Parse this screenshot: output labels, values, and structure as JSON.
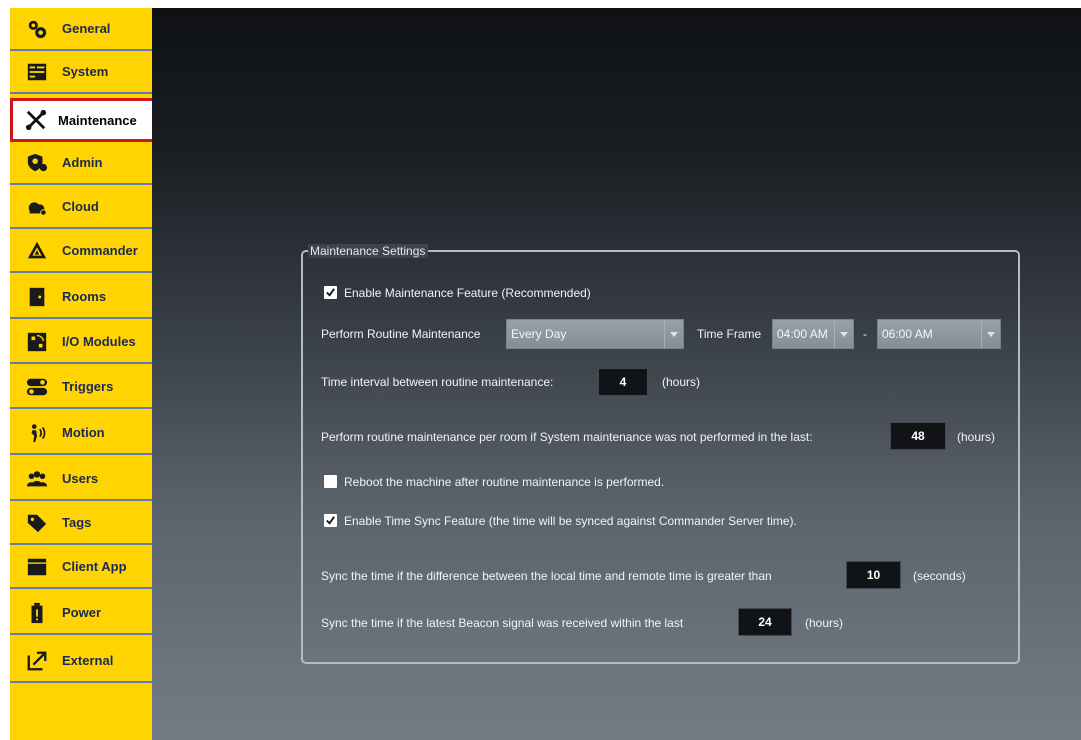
{
  "sidebar": {
    "items": [
      {
        "label": "General",
        "icon": "gears-icon"
      },
      {
        "label": "System",
        "icon": "server-icon"
      },
      {
        "label": "Maintenance",
        "icon": "tools-icon"
      },
      {
        "label": "Admin",
        "icon": "admin-shield-icon"
      },
      {
        "label": "Cloud",
        "icon": "cloud-icon"
      },
      {
        "label": "Commander",
        "icon": "commander-icon"
      },
      {
        "label": "Rooms",
        "icon": "door-icon"
      },
      {
        "label": "I/O Modules",
        "icon": "io-module-icon"
      },
      {
        "label": "Triggers",
        "icon": "toggle-icon"
      },
      {
        "label": "Motion",
        "icon": "motion-icon"
      },
      {
        "label": "Users",
        "icon": "users-icon"
      },
      {
        "label": "Tags",
        "icon": "tag-icon"
      },
      {
        "label": "Client App",
        "icon": "window-icon"
      },
      {
        "label": "Power",
        "icon": "battery-icon"
      },
      {
        "label": "External",
        "icon": "external-link-icon"
      }
    ],
    "selected": "Maintenance"
  },
  "settings": {
    "title": "Maintenance Settings",
    "enable_maintenance": {
      "label": "Enable Maintenance Feature (Recommended)",
      "checked": true
    },
    "routine": {
      "label": "Perform Routine Maintenance",
      "frequency": "Every Day",
      "time_frame_label": "Time Frame",
      "start_time": "04:00 AM",
      "separator": "-",
      "end_time": "06:00 AM"
    },
    "interval": {
      "label": "Time interval between routine maintenance:",
      "value": "4",
      "unit": "(hours)"
    },
    "per_room": {
      "label": "Perform routine maintenance per room if System maintenance was not performed in the last:",
      "value": "48",
      "unit": "(hours)"
    },
    "reboot": {
      "label": "Reboot the machine after routine maintenance is performed.",
      "checked": false
    },
    "time_sync": {
      "label": "Enable Time Sync Feature (the time will be synced against Commander Server time).",
      "checked": true
    },
    "sync_diff": {
      "label": "Sync the time if the difference between the local time and remote time is greater than",
      "value": "10",
      "unit": "(seconds)"
    },
    "beacon": {
      "label": "Sync the time if the latest Beacon signal was received within the last",
      "value": "24",
      "unit": "(hours)"
    }
  },
  "colors": {
    "sidebar": "#ffd400",
    "selected_border": "#d0141c",
    "label_text": "#1a2a55"
  }
}
